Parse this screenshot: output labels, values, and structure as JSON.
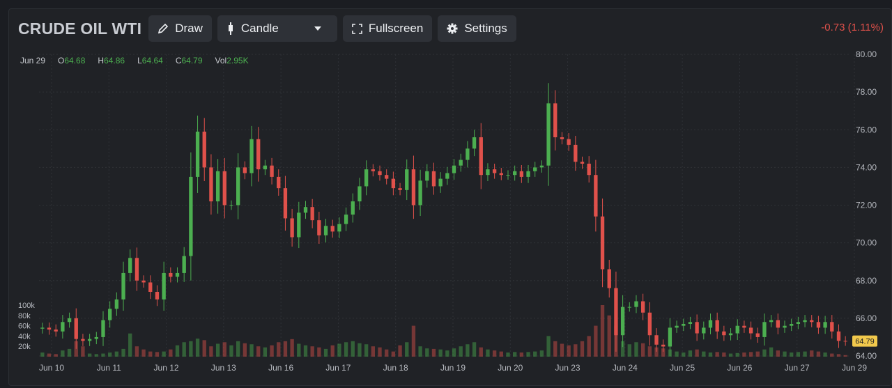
{
  "toolbar": {
    "title": "CRUDE OIL WTI",
    "draw_label": "Draw",
    "chart_type_label": "Candle",
    "fullscreen_label": "Fullscreen",
    "settings_label": "Settings",
    "icons": [
      "pencil-icon",
      "candle-icon",
      "chevron-down-icon",
      "fullscreen-icon",
      "gear-icon"
    ]
  },
  "change_label": "-0.73 (1.11%)",
  "ohlc": {
    "date": "Jun 29",
    "o_label": "O",
    "o": "64.68",
    "h_label": "H",
    "h": "64.86",
    "l_label": "L",
    "l": "64.64",
    "c_label": "C",
    "c": "64.79",
    "vol_label": "Vol",
    "vol": "2.95K"
  },
  "last_price_label": "64.79",
  "colors": {
    "up": "#4caf50",
    "down": "#e0514b",
    "grid": "#2f3237",
    "text": "#b7bac0",
    "badge": "#f2c94c"
  },
  "chart_data": {
    "type": "candlestick",
    "y_ticks": [
      "80.00",
      "78.00",
      "76.00",
      "74.00",
      "72.00",
      "70.00",
      "68.00",
      "66.00",
      "64.00"
    ],
    "ylim": [
      64,
      80
    ],
    "vol_ticks": [
      "100k",
      "80k",
      "60k",
      "40k",
      "20k"
    ],
    "vol_lim": [
      0,
      100000
    ],
    "x_ticks": [
      "Jun 10",
      "Jun 11",
      "Jun 12",
      "Jun 13",
      "Jun 16",
      "Jun 17",
      "Jun 18",
      "Jun 19",
      "Jun 20",
      "Jun 23",
      "Jun 24",
      "Jun 25",
      "Jun 26",
      "Jun 27",
      "Jun 29"
    ],
    "grid": true,
    "series": [
      {
        "name": "Close",
        "values": [
          65.5,
          65.4,
          65.3,
          65.8,
          66.0,
          64.9,
          64.8,
          64.9,
          65.0,
          65.9,
          66.5,
          67.0,
          68.4,
          69.2,
          68.0,
          67.9,
          67.4,
          67.0,
          68.4,
          68.2,
          68.4,
          69.3,
          73.5,
          75.9,
          74.0,
          72.2,
          73.8,
          72.0,
          72.0,
          74.0,
          73.7,
          75.5,
          73.9,
          74.1,
          73.5,
          72.9,
          71.3,
          70.3,
          71.6,
          71.9,
          71.2,
          70.4,
          70.9,
          70.6,
          71.0,
          71.5,
          72.2,
          73.0,
          73.9,
          73.8,
          73.6,
          73.4,
          72.9,
          72.8,
          73.9,
          72.0,
          73.3,
          73.8,
          73.0,
          73.4,
          73.7,
          74.1,
          74.4,
          75.0,
          75.6,
          73.6,
          73.9,
          73.7,
          73.6,
          73.6,
          73.8,
          73.5,
          73.8,
          74.0,
          74.1,
          77.4,
          75.6,
          75.5,
          75.2,
          74.3,
          74.2,
          73.6,
          71.4,
          68.6,
          67.6,
          65.1,
          66.6,
          66.6,
          66.9,
          66.3,
          65.1,
          64.6,
          64.5,
          65.5,
          65.6,
          65.7,
          65.8,
          65.2,
          65.5,
          65.9,
          65.3,
          65.1,
          65.2,
          65.6,
          65.5,
          65.2,
          65.0,
          65.8,
          65.9,
          65.5,
          65.6,
          65.7,
          65.8,
          65.9,
          65.8,
          65.5,
          65.8,
          65.3,
          64.8,
          64.79
        ]
      },
      {
        "name": "Volume",
        "values": [
          8000,
          6000,
          5000,
          12000,
          15000,
          30000,
          20000,
          6000,
          5000,
          6000,
          8000,
          10000,
          15000,
          45000,
          20000,
          14000,
          10000,
          9000,
          10000,
          14000,
          22000,
          28000,
          30000,
          35000,
          32000,
          20000,
          25000,
          28000,
          22000,
          30000,
          26000,
          24000,
          20000,
          18000,
          22000,
          28000,
          30000,
          34000,
          25000,
          22000,
          20000,
          18000,
          15000,
          22000,
          25000,
          28000,
          30000,
          26000,
          24000,
          20000,
          18000,
          14000,
          10000,
          22000,
          28000,
          60000,
          20000,
          16000,
          15000,
          14000,
          12000,
          16000,
          20000,
          24000,
          28000,
          18000,
          14000,
          12000,
          10000,
          8000,
          9000,
          8000,
          9000,
          10000,
          12000,
          40000,
          30000,
          25000,
          22000,
          24000,
          30000,
          40000,
          60000,
          100000,
          80000,
          60000,
          30000,
          24000,
          28000,
          26000,
          20000,
          18000,
          16000,
          14000,
          10000,
          8000,
          12000,
          14000,
          10000,
          8000,
          9000,
          8000,
          6000,
          7000,
          8000,
          9000,
          10000,
          14000,
          18000,
          12000,
          10000,
          8000,
          9000,
          10000,
          12000,
          10000,
          8000,
          6000,
          5000,
          3000
        ]
      }
    ]
  }
}
